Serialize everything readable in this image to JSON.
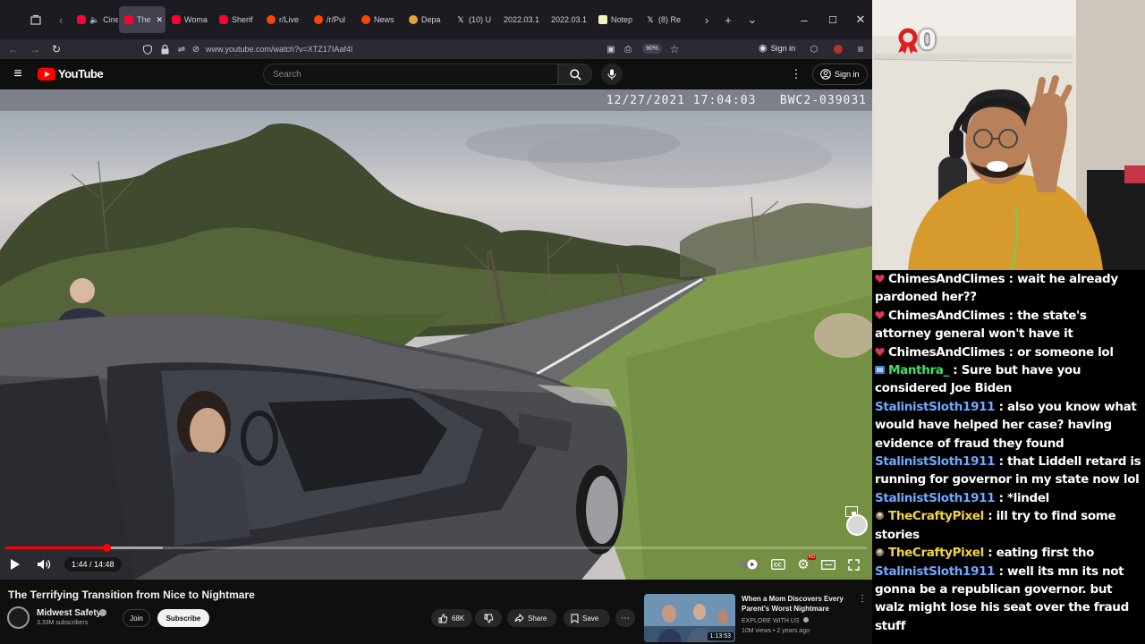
{
  "browser": {
    "tabs": [
      {
        "label": "Cinem",
        "favicon": "youtube-icon",
        "muted": true
      },
      {
        "label": "The",
        "favicon": "youtube-icon",
        "active": true
      },
      {
        "label": "Woma",
        "favicon": "youtube-icon"
      },
      {
        "label": "Sherif",
        "favicon": "youtube-icon"
      },
      {
        "label": "r/Live",
        "favicon": "reddit-icon"
      },
      {
        "label": "/r/Pul",
        "favicon": "reddit-icon"
      },
      {
        "label": "News",
        "favicon": "reddit-icon"
      },
      {
        "label": "Depa",
        "favicon": "generic-icon"
      },
      {
        "label": "(10) U",
        "favicon": "x-icon"
      },
      {
        "label": "2022.03.1",
        "favicon": "none"
      },
      {
        "label": "2022.03.1",
        "favicon": "none"
      },
      {
        "label": "Notep",
        "favicon": "notepad-icon"
      },
      {
        "label": "(8) Re",
        "favicon": "x-icon"
      }
    ],
    "url": "www.youtube.com/watch?v=XTZ17IAaf4I",
    "zoom": "90%",
    "sign_in_label": "Sign in"
  },
  "youtube": {
    "logo_text": "YouTube",
    "search_placeholder": "Search",
    "sign_in_label": "Sign in"
  },
  "video": {
    "bodycam_timestamp": "12/27/2021 17:04:03",
    "bodycam_id": "BWC2-039031",
    "current_time": "1:44",
    "duration": "14:48",
    "time_display": "1:44 / 14:48",
    "progress_fraction": 0.117,
    "buffered_fraction": 0.183,
    "title": "The Terrifying Transition from Nice to Nightmare"
  },
  "channel": {
    "name": "Midwest Safety",
    "subscribers": "3.33M subscribers",
    "join_label": "Join",
    "subscribe_label": "Subscribe"
  },
  "actions": {
    "likes": "68K",
    "share_label": "Share",
    "save_label": "Save"
  },
  "recommendation": {
    "title": "When a Mom Discovers Every Parent's Worst Nightmare",
    "channel": "EXPLORE WITH US",
    "meta": "10M views • 2 years ago",
    "duration": "1:13:53"
  },
  "webcam": {
    "counter_value": "0",
    "counter_icon": "red-ribbon-icon"
  },
  "chat": {
    "messages": [
      {
        "user": "ChimesAndClimes",
        "color": "#ffffff",
        "badge": "heart",
        "text": "wait he already pardoned her??"
      },
      {
        "user": "ChimesAndClimes",
        "color": "#ffffff",
        "badge": "heart",
        "text": "the state's attorney general won't have it"
      },
      {
        "user": "ChimesAndClimes",
        "color": "#ffffff",
        "badge": "heart",
        "text": "or someone lol"
      },
      {
        "user": "Manthra_",
        "color": "#3ee06b",
        "badge": "sub",
        "text": "Sure but have you considered Joe Biden"
      },
      {
        "user": "StalinistSloth1911",
        "color": "#6ea8ff",
        "badge": "none",
        "text": "also you know what would have helped her case? having evidence of fraud they found"
      },
      {
        "user": "StalinistSloth1911",
        "color": "#6ea8ff",
        "badge": "none",
        "text": "that Liddell retard is running for governor in my state now lol"
      },
      {
        "user": "StalinistSloth1911",
        "color": "#6ea8ff",
        "badge": "none",
        "text": "*lindel"
      },
      {
        "user": "TheCraftyPixel",
        "color": "#f2d53b",
        "badge": "crafty",
        "text": "ill try to find some stories"
      },
      {
        "user": "TheCraftyPixel",
        "color": "#f2d53b",
        "badge": "crafty",
        "text": "eating first tho"
      },
      {
        "user": "StalinistSloth1911",
        "color": "#6ea8ff",
        "badge": "none",
        "text": "well its mn its not gonna be a republican governor. but walz might lose his seat over the fraud stuff"
      }
    ]
  }
}
